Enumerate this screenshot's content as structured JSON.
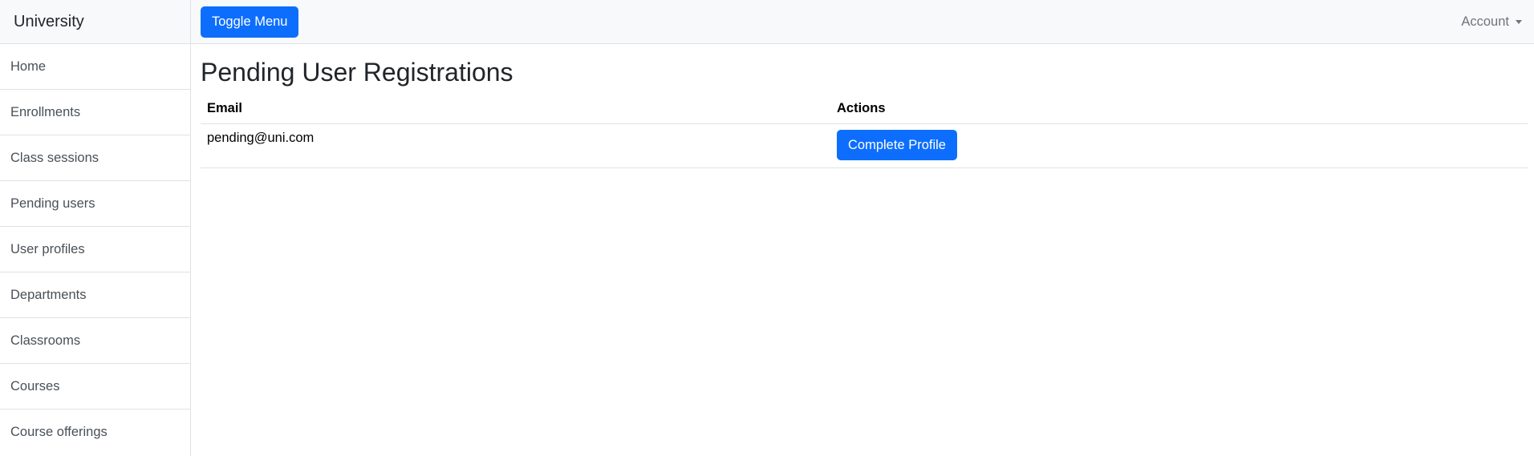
{
  "sidebar": {
    "brand": "University",
    "items": [
      {
        "label": "Home"
      },
      {
        "label": "Enrollments"
      },
      {
        "label": "Class sessions"
      },
      {
        "label": "Pending users"
      },
      {
        "label": "User profiles"
      },
      {
        "label": "Departments"
      },
      {
        "label": "Classrooms"
      },
      {
        "label": "Courses"
      },
      {
        "label": "Course offerings"
      }
    ]
  },
  "topnav": {
    "toggle_label": "Toggle Menu",
    "account_label": "Account"
  },
  "main": {
    "title": "Pending User Registrations",
    "table": {
      "columns": [
        "Email",
        "Actions"
      ],
      "rows": [
        {
          "email": "pending@uni.com",
          "action_label": "Complete Profile"
        }
      ]
    }
  },
  "colors": {
    "primary": "#0d6efd",
    "nav_bg": "#f8f9fa",
    "border": "#dee2e6"
  }
}
